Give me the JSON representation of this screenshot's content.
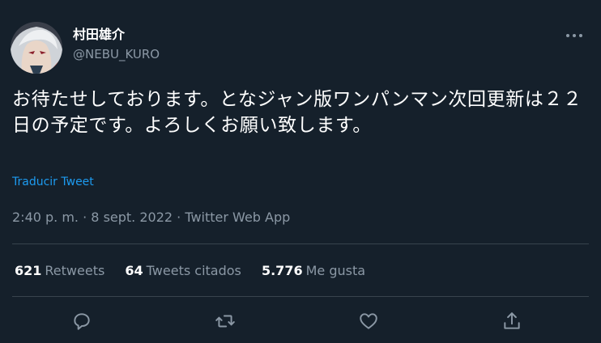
{
  "user": {
    "name": "村田雄介",
    "handle": "@NEBU_KURO",
    "avatar_icon": "avatar-image"
  },
  "tweet": {
    "text": "お待たせしております。となジャン版ワンパンマン次回更新は２２日の予定です。よろしくお願い致します。",
    "translate_label": "Traducir Tweet",
    "time": "2:40 p. m.",
    "separator": "·",
    "date": "8 sept. 2022",
    "source": "Twitter Web App"
  },
  "stats": {
    "retweets_count": "621",
    "retweets_label": "Retweets",
    "quotes_count": "64",
    "quotes_label": "Tweets citados",
    "likes_count": "5.776",
    "likes_label": "Me gusta"
  },
  "actions": {
    "icons": [
      "reply-icon",
      "retweet-icon",
      "like-icon",
      "share-icon"
    ]
  },
  "colors": {
    "background": "#15202b",
    "accent": "#1d9bf0",
    "muted_text": "#8b98a5",
    "divider": "#38444d"
  }
}
